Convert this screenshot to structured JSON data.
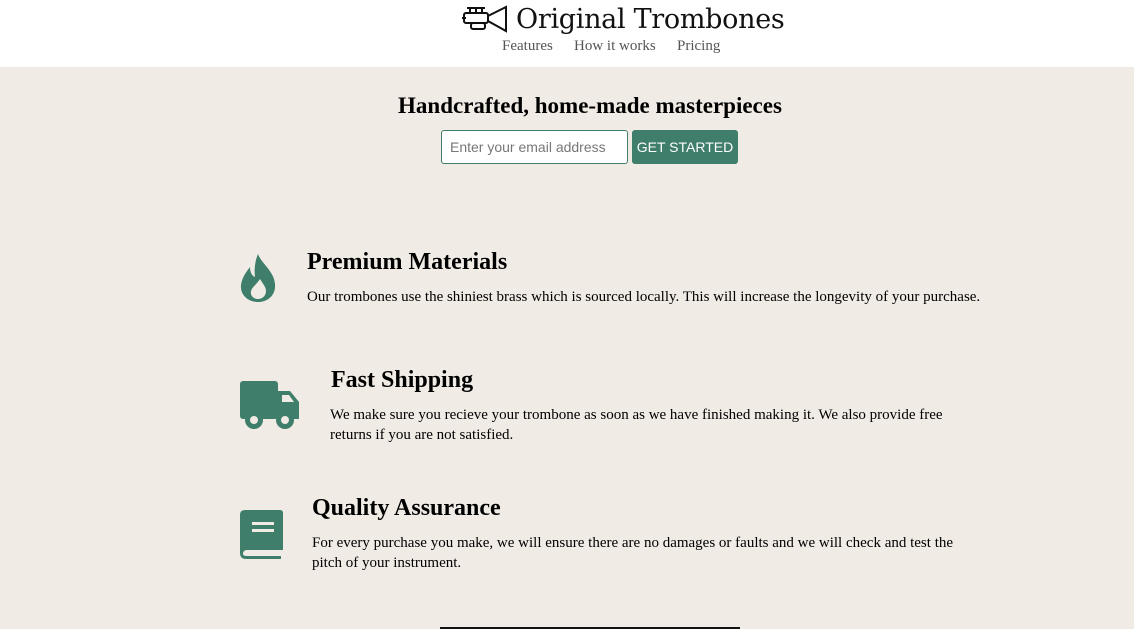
{
  "header": {
    "logo_icon": "trumpet-icon",
    "brand_name": "Original Trombones",
    "nav": [
      {
        "label": "Features"
      },
      {
        "label": "How it works"
      },
      {
        "label": "Pricing"
      }
    ]
  },
  "hero": {
    "title": "Handcrafted, home-made masterpieces",
    "email_placeholder": "Enter your email address",
    "cta_label": "GET STARTED"
  },
  "features": [
    {
      "icon": "fire-icon",
      "title": "Premium Materials",
      "description": "Our trombones use the shiniest brass which is sourced locally. This will increase the longevity of your purchase."
    },
    {
      "icon": "truck-icon",
      "title": "Fast Shipping",
      "description": "We make sure you recieve your trombone as soon as we have finished making it. We also provide free returns if you are not satisfied."
    },
    {
      "icon": "book-icon",
      "title": "Quality Assurance",
      "description": "For every purchase you make, we will ensure there are no damages or faults and we will check and test the pitch of your instrument."
    }
  ],
  "colors": {
    "accent": "#3e7e6a",
    "background": "#f1ebe5",
    "header_background": "#ffffff"
  }
}
